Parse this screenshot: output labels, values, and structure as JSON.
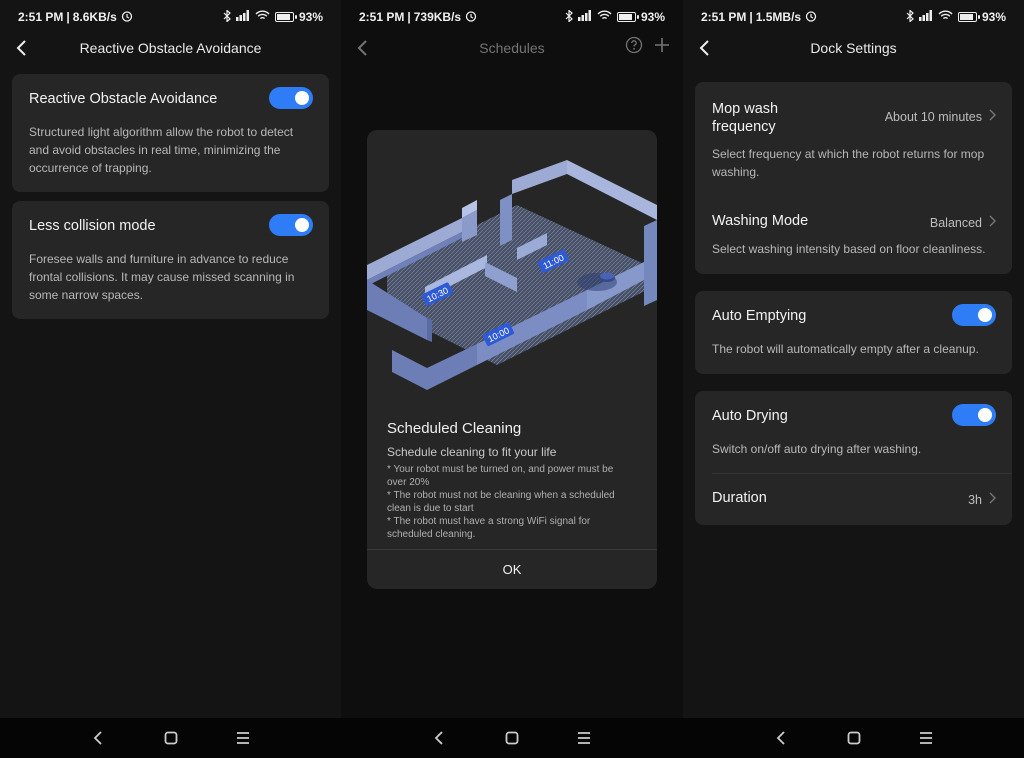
{
  "screens": [
    {
      "status": {
        "time": "2:51 PM",
        "speed": "8.6KB/s",
        "battery": "93"
      },
      "title": "Reactive Obstacle Avoidance",
      "cards": [
        {
          "title": "Reactive Obstacle Avoidance",
          "desc": "Structured light algorithm allow the robot to detect and avoid obstacles in real time, minimizing the occurrence of trapping.",
          "toggle": true
        },
        {
          "title": "Less collision mode",
          "desc": "Foresee walls and furniture in advance to reduce frontal collisions. It may cause missed scanning in some narrow spaces.",
          "toggle": true
        }
      ]
    },
    {
      "status": {
        "time": "2:51 PM",
        "speed": "739KB/s",
        "battery": "93"
      },
      "title": "Schedules",
      "dialog": {
        "title": "Scheduled Cleaning",
        "subtitle": "Schedule cleaning to fit your life",
        "notes": [
          "* Your robot must be turned on, and power must be over 20%",
          "* The robot must not be cleaning when a scheduled clean is due to start",
          "* The robot must have a strong WiFi signal for scheduled cleaning."
        ],
        "ok_label": "OK",
        "map_labels": [
          "10:30",
          "11:00",
          "10:00"
        ]
      }
    },
    {
      "status": {
        "time": "2:51 PM",
        "speed": "1.5MB/s",
        "battery": "93"
      },
      "title": "Dock Settings",
      "mop_wash": {
        "title": "Mop wash frequency",
        "value": "About 10 minutes",
        "desc": "Select frequency at which the robot returns for mop washing."
      },
      "washing_mode": {
        "title": "Washing Mode",
        "value": "Balanced",
        "desc": "Select washing intensity based on floor cleanliness."
      },
      "auto_emptying": {
        "title": "Auto Emptying",
        "desc": "The robot will automatically empty after a cleanup.",
        "toggle": true
      },
      "auto_drying": {
        "title": "Auto Drying",
        "desc": "Switch on/off auto drying after washing.",
        "toggle": true
      },
      "duration": {
        "title": "Duration",
        "value": "3h"
      }
    }
  ],
  "colors": {
    "accent": "#2e7cf6",
    "card": "#262626",
    "background": "#141414"
  },
  "icons": [
    "back-arrow-icon",
    "help-icon",
    "add-icon",
    "bluetooth-icon",
    "signal-icon",
    "wifi-icon",
    "alarm-icon",
    "battery-icon",
    "chevron-right-icon",
    "nav-back-icon",
    "nav-home-icon",
    "nav-menu-icon"
  ]
}
